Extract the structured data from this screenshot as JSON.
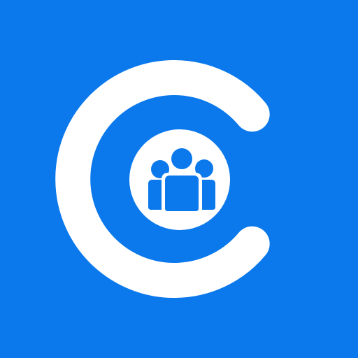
{
  "app_icon": {
    "logo_name": "c-letter-group-logo",
    "colors": {
      "background": "#0b79ec",
      "foreground": "#ffffff"
    }
  }
}
